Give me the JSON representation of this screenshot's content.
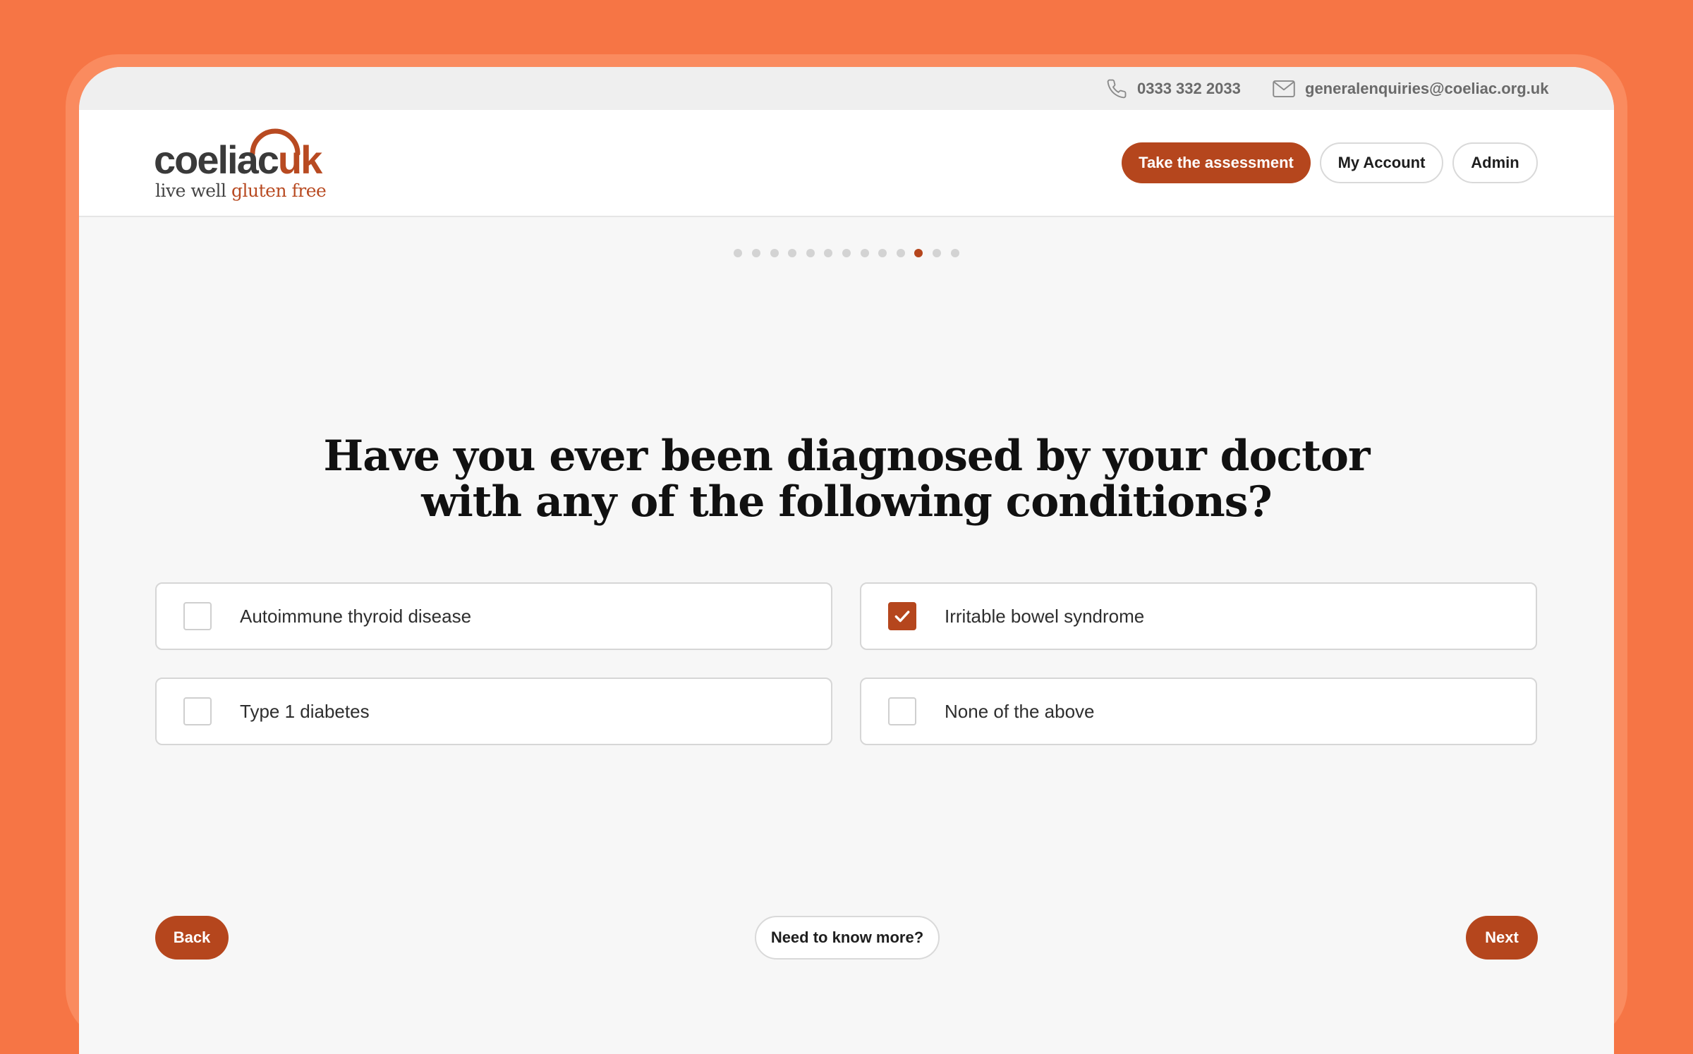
{
  "topbar": {
    "phone": "0333 332 2033",
    "email": "generalenquiries@coeliac.org.uk",
    "phone_icon": "phone-icon",
    "email_icon": "envelope-icon"
  },
  "logo": {
    "word_main": "coeliac",
    "word_accent": "uk",
    "tagline_main": "live well",
    "tagline_accent": "gluten free"
  },
  "header": {
    "assessment_label": "Take the assessment",
    "account_label": "My Account",
    "admin_label": "Admin"
  },
  "progress": {
    "total_steps": 13,
    "current_step": 11
  },
  "question": {
    "line1": "Have you ever been diagnosed by your doctor",
    "line2": "with any of the following conditions?"
  },
  "options": [
    {
      "label": "Autoimmune thyroid disease",
      "checked": false
    },
    {
      "label": "Irritable bowel syndrome",
      "checked": true
    },
    {
      "label": "Type 1 diabetes",
      "checked": false
    },
    {
      "label": "None of the above",
      "checked": false
    }
  ],
  "footer": {
    "back_label": "Back",
    "more_label": "Need to know more?",
    "next_label": "Next"
  },
  "colors": {
    "background": "#f67545",
    "brand": "#b5461d"
  }
}
